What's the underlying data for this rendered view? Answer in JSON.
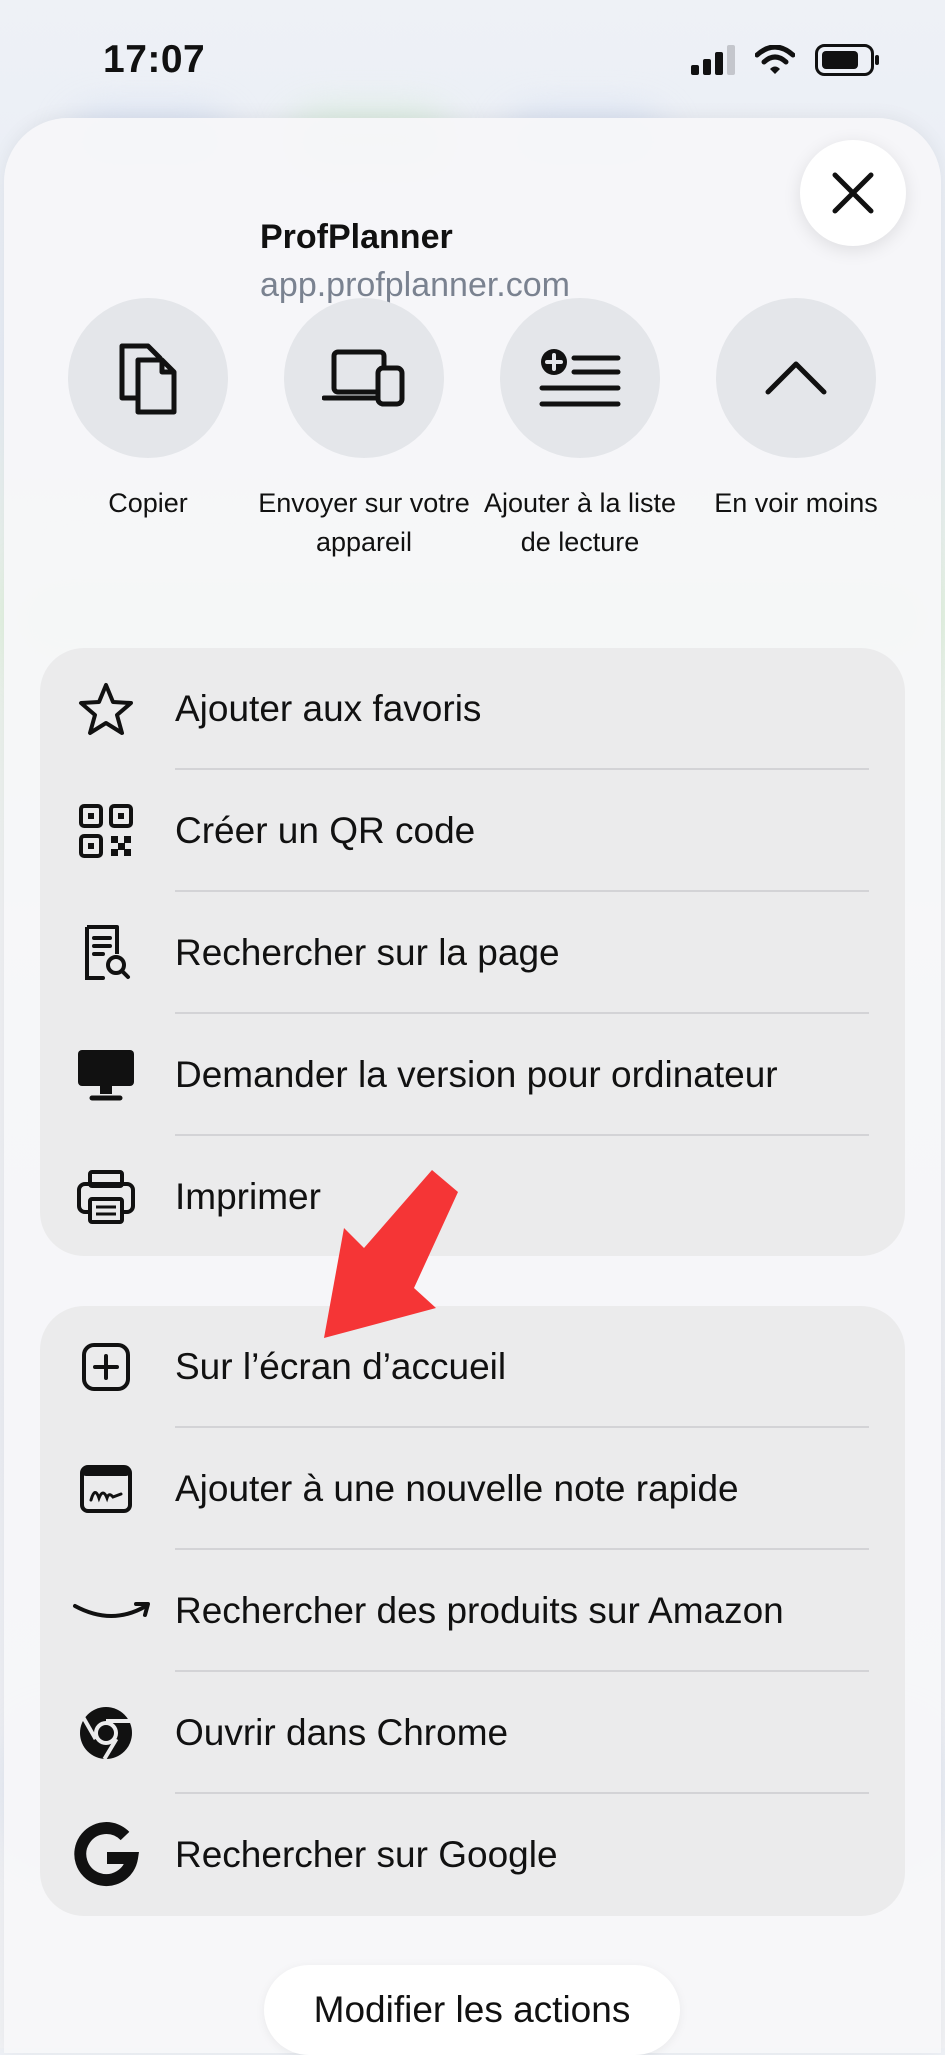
{
  "status": {
    "time": "17:07"
  },
  "site": {
    "name": "ProfPlanner",
    "url": "app.profplanner.com"
  },
  "quick_actions": [
    {
      "label": "Copier",
      "icon": "copy-icon"
    },
    {
      "label": "Envoyer sur votre appareil",
      "icon": "devices-icon"
    },
    {
      "label": "Ajouter à la liste de lecture",
      "icon": "reading-list-icon"
    },
    {
      "label": "En voir moins",
      "icon": "chevron-up-icon"
    }
  ],
  "group1": [
    {
      "label": "Ajouter aux favoris",
      "icon": "star-icon"
    },
    {
      "label": "Créer un QR code",
      "icon": "qr-code-icon"
    },
    {
      "label": "Rechercher sur la page",
      "icon": "find-in-page-icon"
    },
    {
      "label": "Demander la version pour ordinateur",
      "icon": "desktop-icon"
    },
    {
      "label": "Imprimer",
      "icon": "printer-icon"
    }
  ],
  "group2": [
    {
      "label": "Sur l’écran d’accueil",
      "icon": "add-square-icon"
    },
    {
      "label": "Ajouter à une nouvelle note rapide",
      "icon": "quick-note-icon"
    },
    {
      "label": "Rechercher des produits sur Amazon",
      "icon": "amazon-icon"
    },
    {
      "label": "Ouvrir dans Chrome",
      "icon": "chrome-icon"
    },
    {
      "label": "Rechercher sur Google",
      "icon": "google-icon"
    }
  ],
  "footer": {
    "edit_actions_label": "Modifier les actions"
  },
  "colors": {
    "annotation_arrow": "#f53536",
    "sheet": "#f6f7f9",
    "group": "#ebebec",
    "url_text": "#7a8290"
  }
}
